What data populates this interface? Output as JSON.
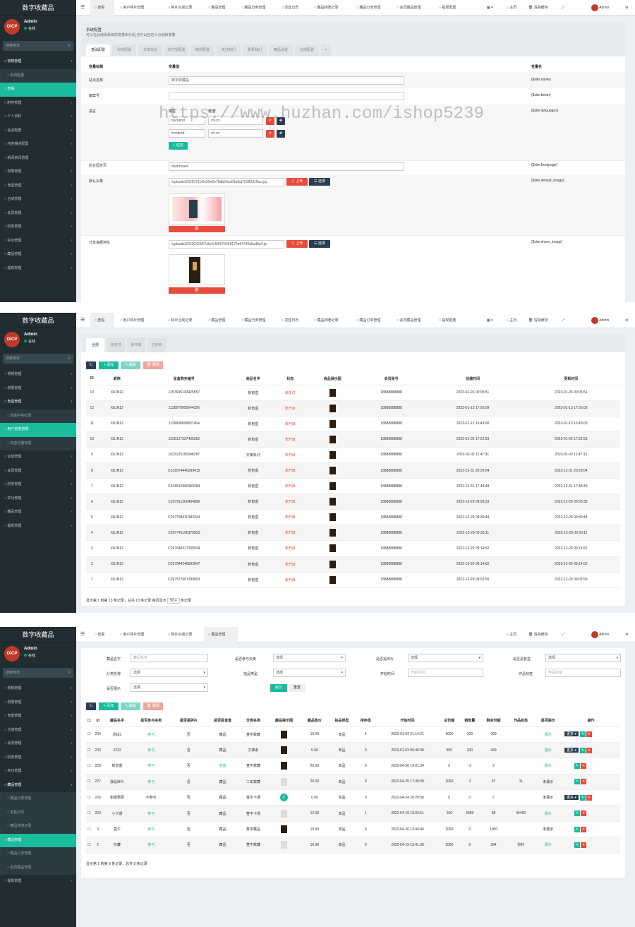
{
  "app": {
    "brand": "数字收藏品",
    "admin": "Admin",
    "online": "在线",
    "search_placeholder": "搜索菜单",
    "avatar_text": "OICP",
    "admin_short": "Admin"
  },
  "top": {
    "home": "主页",
    "clear": "清除缓存"
  },
  "p1": {
    "tabs": [
      "查看",
      "用户碎片管理",
      "碎片合成记录",
      "藏品管理",
      "藏品分类管理",
      "发售日历",
      "藏品转赠记录",
      "藏品订单管理",
      "会员藏品管理",
      "提现配置"
    ],
    "menu": [
      {
        "t": "常规管理",
        "k": "hd"
      },
      {
        "t": "系统配置",
        "k": "sub"
      },
      {
        "t": "查看",
        "k": "act"
      },
      {
        "t": "附件管理",
        "k": ""
      },
      {
        "t": "个人资料",
        "k": ""
      },
      {
        "t": "站点配置",
        "k": ""
      },
      {
        "t": "内容描述配置",
        "k": ""
      },
      {
        "t": "新闻资讯管理",
        "k": ""
      },
      {
        "t": "权限管理",
        "k": ""
      },
      {
        "t": "盲盒管理",
        "k": ""
      },
      {
        "t": "合成管理",
        "k": ""
      },
      {
        "t": "会员管理",
        "k": ""
      },
      {
        "t": "财务管理",
        "k": ""
      },
      {
        "t": "实功管理",
        "k": ""
      },
      {
        "t": "藏品管理",
        "k": ""
      },
      {
        "t": "提现管理",
        "k": ""
      }
    ],
    "title": "系统配置",
    "subtitle": "可以在此增改系统的变量和分组,也可以自定义分组和变量",
    "cfgtabs": [
      "基础配置",
      "币商配置",
      "文本协议",
      "支付宝配置",
      "微信配置",
      "关注我们",
      "联系我们",
      "藏品设置",
      "合成配置",
      "+"
    ],
    "head": {
      "c1": "变量标题",
      "c2": "变量值",
      "c3": "变量名"
    },
    "rows": {
      "name": {
        "label": "站点名称",
        "value": "数字收藏品",
        "var": "{$site.name}"
      },
      "beian": {
        "label": "备案号",
        "value": "",
        "var": "{$site.beian}"
      },
      "lang": {
        "label": "语言",
        "k": "键名",
        "v": "键值",
        "k1": "backend",
        "v1": "zh-cn",
        "k2": "frontend",
        "v2": "zh-cn",
        "add": "+ 追加",
        "var": "{$site.languages}"
      },
      "fixed": {
        "label": "后台固定页",
        "value": "dashboard",
        "var": "{$site.fixedpage}"
      },
      "avatar": {
        "label": "默认头像",
        "value": "/uploads/20220711/6e59e5e78db2dca09afbd75392d10ac.jpg",
        "upload": "上传",
        "choose": "选择",
        "del": "删",
        "var": "{$site.default_image}"
      },
      "share": {
        "label": "分享海报地址",
        "value": "/uploads/20220423/57ebc1489570469170e64740abcd5a4.jp",
        "upload": "上传",
        "choose": "选择",
        "del": "删",
        "var": "{$site.share_image}"
      }
    }
  },
  "watermark": "https://www.huzhan.com/ishop5239",
  "p2": {
    "tabs": [
      "查看",
      "用户碎片管理",
      "碎片合成记录",
      "藏品管理",
      "藏品分类管理",
      "发售日历",
      "藏品转赠记录",
      "藏品订单管理",
      "会员藏品管理",
      "提现配置"
    ],
    "menu": [
      {
        "t": "常规管理",
        "k": ""
      },
      {
        "t": "权限管理",
        "k": ""
      },
      {
        "t": "盲盒管理",
        "k": "hd"
      },
      {
        "t": "盲盒中奖纪录",
        "k": "sub"
      },
      {
        "t": "用户盲盒管理",
        "k": "act"
      },
      {
        "t": "盲盒轮播管理",
        "k": "sub"
      },
      {
        "t": "合成管理",
        "k": ""
      },
      {
        "t": "会员管理",
        "k": ""
      },
      {
        "t": "财务管理",
        "k": ""
      },
      {
        "t": "实功管理",
        "k": ""
      },
      {
        "t": "藏品管理",
        "k": ""
      },
      {
        "t": "提现管理",
        "k": ""
      }
    ],
    "filters": [
      "全部",
      "未支付",
      "未开启",
      "已开启"
    ],
    "btns": {
      "add": "+ 添加",
      "edit": "编辑",
      "del": "删除"
    },
    "cols": [
      "ID",
      "昵称",
      "盲盒购买编号",
      "商品名字",
      "状态",
      "商品展示图",
      "会员账号",
      "创建时间",
      "更新时间"
    ],
    "rows": [
      [
        "13",
        "XILIN12",
        "1257635133425557",
        "新盲盒",
        "未支付",
        "18888888888",
        "2023-01-26 00:05:51",
        "2023-01-26 00:05:51"
      ],
      [
        "12",
        "XILIN12",
        "1130070905644226",
        "新盲盒",
        "未开启",
        "18888888888",
        "2023-01-13 17:05:09",
        "2023-01-13 17:05:09"
      ],
      [
        "11",
        "XILIN12",
        "1139938008837454",
        "新盲盒",
        "未开启",
        "18888888888",
        "2023-01-13 16:43:00",
        "2023-01-13 16:43:00"
      ],
      [
        "10",
        "XILIN12",
        "1025137337435362",
        "新盲盒",
        "未开启",
        "18888888888",
        "2023-01-02 17:22:53",
        "2023-01-02 17:22:53"
      ],
      [
        "9",
        "XILIN12",
        "1023125190348287",
        "文莱系列",
        "未开启",
        "18888888888",
        "2023-01-02 11:47:31",
        "2023-01-02 11:47:31"
      ],
      [
        "8",
        "XILIN12",
        "C318974446299415",
        "新盲盒",
        "未开启",
        "18888888888",
        "2022-12-31 20:29:04",
        "2022-12-31 20:29:04"
      ],
      [
        "7",
        "XILIN12",
        "C318912966358284",
        "新盲盒",
        "未开启",
        "18888888888",
        "2022-12-31 17:48:49",
        "2022-12-31 17:48:49"
      ],
      [
        "6",
        "XILIN12",
        "C297911360494896",
        "新盲盒",
        "未开启",
        "18888888888",
        "2022-12-29 09:58:33",
        "2022-12-29 09:58:33"
      ],
      [
        "5",
        "XILIN12",
        "C297798430182934",
        "新盲盒",
        "未开启",
        "18888888888",
        "2022-12-29 09:39:44",
        "2022-12-29 09:39:44"
      ],
      [
        "4",
        "XILIN12",
        "C297741190379823",
        "新盲盒",
        "未开启",
        "18888888888",
        "2022-12-29 09:30:11",
        "2022-12-29 09:30:11"
      ],
      [
        "3",
        "XILIN12",
        "C297649227255534",
        "新盲盒",
        "未开启",
        "18888888888",
        "2022-12-29 09:14:52",
        "2022-12-29 09:14:52"
      ],
      [
        "2",
        "XILIN12",
        "C297644246502847",
        "新盲盒",
        "未开启",
        "18888888888",
        "2022-12-29 09:14:02",
        "2022-12-29 09:14:02"
      ],
      [
        "1",
        "XILIN12",
        "C297577667339893",
        "新盲盒",
        "未开启",
        "18888888888",
        "2022-12-29 09:02:56",
        "2022-12-29 09:02:56"
      ]
    ],
    "footer1": "显示第 1 到第 13 条记录，总共 13 条记录 每页显示",
    "pagesize": "50",
    "footer2": "条记录"
  },
  "p3": {
    "tabs": [
      "查看",
      "用户碎片管理",
      "碎片合成记录",
      "藏品管理"
    ],
    "menu": [
      {
        "t": "常规管理",
        "k": ""
      },
      {
        "t": "权限管理",
        "k": ""
      },
      {
        "t": "盲盒管理",
        "k": ""
      },
      {
        "t": "合成管理",
        "k": ""
      },
      {
        "t": "会员管理",
        "k": ""
      },
      {
        "t": "财务管理",
        "k": ""
      },
      {
        "t": "实功管理",
        "k": ""
      },
      {
        "t": "藏品管理",
        "k": "hd"
      },
      {
        "t": "藏品分类管理",
        "k": "sub"
      },
      {
        "t": "发售日历",
        "k": "sub"
      },
      {
        "t": "藏品转赠记录",
        "k": "sub"
      },
      {
        "t": "藏品管理",
        "k": "act"
      },
      {
        "t": "藏品订单管理",
        "k": "sub"
      },
      {
        "t": "会员藏品管理",
        "k": "sub"
      },
      {
        "t": "提现管理",
        "k": ""
      }
    ],
    "form": {
      "l1": "藏品名字",
      "p1": "藏品名字",
      "l2": "是否参与买卖",
      "s2": "选择",
      "l3": "是否是碎片",
      "s3": "选择",
      "l4": "是否是盲盒",
      "s4": "选择",
      "l5": "分类名称",
      "s5": "选择",
      "l6": "拍品类型",
      "s6": "选择",
      "l7": "开始时间",
      "p7": "开始时间",
      "l8": "作品标签",
      "p8": "作品标签",
      "l9": "是否展示",
      "s9": "选择",
      "submit": "提交",
      "reset": "重置"
    },
    "btns": {
      "add": "+ 添加",
      "edit": "编辑",
      "del": "删除"
    },
    "cols": [
      "Id",
      "藏品名字",
      "是否参与买卖",
      "是否是碎片",
      "是否是盲盒",
      "分类名称",
      "藏品展示图",
      "藏品售价",
      "拍品类型",
      "排序值",
      "开始时间",
      "总份额",
      "销售量",
      "剩余份额",
      "作品标签",
      "是否展示",
      "操作"
    ],
    "rows": [
      [
        "234",
        "测试1",
        "参与",
        "否",
        "藏品",
        "萱牛数藏",
        "16.00",
        "单品",
        "4",
        "2023-01-04 21:14:21",
        "1000",
        "100",
        "999",
        "",
        "展示"
      ],
      [
        "233",
        "2222",
        "参与",
        "否",
        "藏品",
        "文莱系",
        "5.00",
        "单品",
        "0",
        "2023-01-03 06:40:38",
        "500",
        "100",
        "499",
        "",
        "展示"
      ],
      [
        "228",
        "新盲盒",
        "参与",
        "否",
        "盲盒",
        "萱牛数藏",
        "20.00",
        "单品",
        "0",
        "2022-04-26 14:01:34",
        "0",
        "-2",
        "2",
        "",
        "展示"
      ],
      [
        "227",
        "我是碎片",
        "参与",
        "否",
        "藏品",
        "二年数藏",
        "20.00",
        "单品",
        "0",
        "2022-04-25 17:49:00",
        "1000",
        "3",
        "97",
        "11",
        "未展示"
      ],
      [
        "226",
        "谢谢惠顾",
        "不参与",
        "否",
        "藏品",
        "萱牛卡通",
        "0.00",
        "单品",
        "0",
        "2022-04-24 20:29:56",
        "0",
        "0",
        "0",
        "",
        "未展示"
      ],
      [
        "224",
        "小卡通",
        "参与",
        "否",
        "藏品",
        "萱牛卡通",
        "12.00",
        "单品",
        "1",
        "2022-04-19 13:03:51",
        "100",
        "5689",
        "98",
        "44466",
        "展示"
      ],
      [
        "3",
        "萱牛",
        "参与",
        "否",
        "藏品",
        "数字藏品",
        "19.90",
        "单品",
        "0",
        "2022-04-26 13:44:44",
        "1000",
        "0",
        "1000",
        "",
        "未展示"
      ],
      [
        "2",
        "珍藏",
        "参与",
        "否",
        "藏品",
        "萱牛数藏",
        "19.90",
        "单品",
        "0",
        "2022-04-19 13:41:38",
        "1000",
        "6",
        "994",
        "你好",
        "展示"
      ]
    ],
    "more": "更多",
    "footer": "显示第 1 到第 8 条记录，总共 8 条记录"
  }
}
